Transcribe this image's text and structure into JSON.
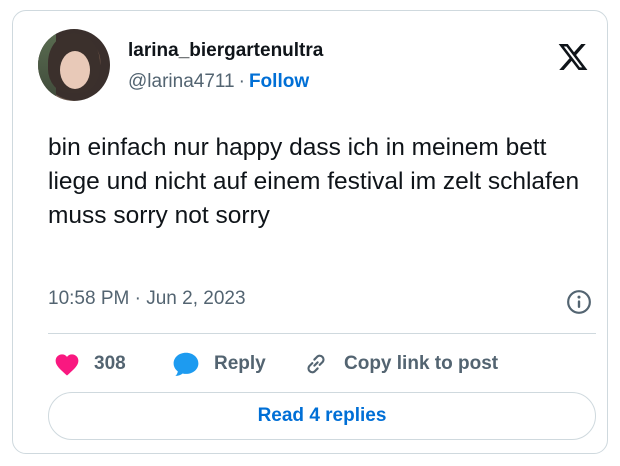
{
  "author": {
    "display_name": "larina_biergartenultra",
    "handle": "@larina4711",
    "separator": "·",
    "follow_label": "Follow"
  },
  "tweet": {
    "text": "bin einfach nur happy dass ich in meinem bett liege und nicht auf einem festival im zelt schlafen muss sorry not sorry",
    "timestamp": "10:58 PM · Jun 2, 2023"
  },
  "actions": {
    "like_count": "308",
    "reply_label": "Reply",
    "copy_label": "Copy link to post"
  },
  "footer": {
    "read_replies_label": "Read 4 replies"
  },
  "colors": {
    "like": "#f91880",
    "reply": "#1d9bf0",
    "link": "#006fd6",
    "muted": "#536471",
    "border": "#cfd9de"
  },
  "icons": [
    "x-logo-icon",
    "info-icon",
    "heart-icon",
    "reply-bubble-icon",
    "link-icon"
  ]
}
